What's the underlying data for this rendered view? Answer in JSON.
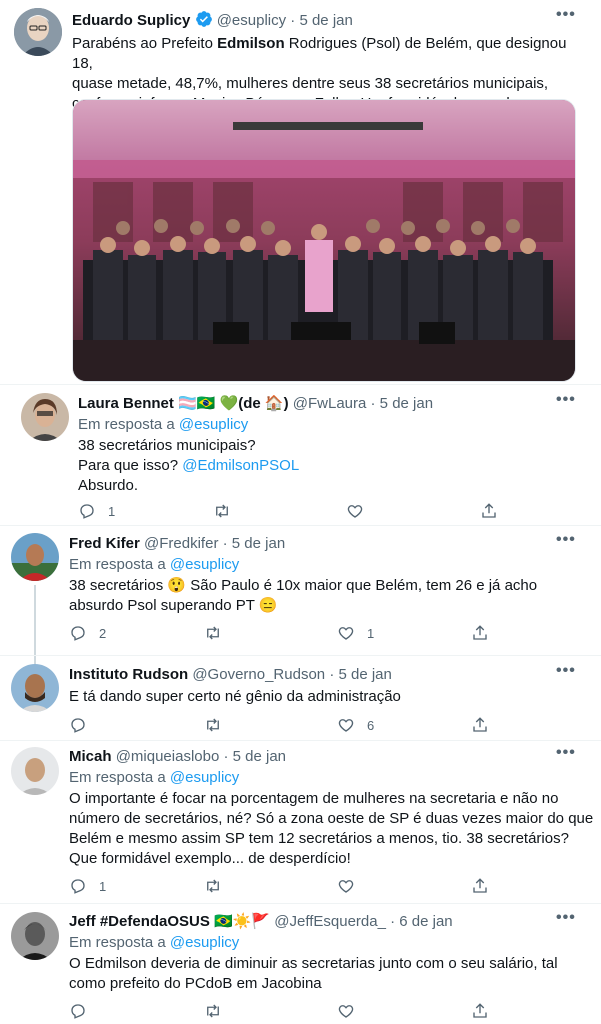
{
  "tweets": [
    {
      "name": "Eduardo Suplicy",
      "handle": "@esuplicy",
      "date": "· 5 de jan",
      "text_pre": "Parabéns ao Prefeito ",
      "text_bold": "Edmilson",
      "text_post": " Rodrigues (Psol) de Belém, que designou 18,",
      "text_line2": "quase metade, 48,7%, mulheres dentre seus 38 secretários municipais,",
      "text_line3": "conforme informa Monica Bérgamo, Folha. Um formidável exemplo.",
      "icon": "verified-badge-icon"
    },
    {
      "name": "Laura Bennet",
      "name_emoji": "🏳️‍⚧️🇧🇷 💚(de 🏠)",
      "handle": "@FwLaura",
      "date": "· 5 de jan",
      "reply_label": "Em resposta a",
      "reply_to": "@esuplicy",
      "line1": "38 secretários municipais?",
      "line2_pre": "Para que isso? ",
      "line2_link": "@EdmilsonPSOL",
      "line3": "Absurdo.",
      "replies": "1",
      "likes": ""
    },
    {
      "name": "Fred Kifer",
      "handle": "@Fredkifer",
      "date": "· 5 de jan",
      "reply_label": "Em resposta a",
      "reply_to": "@esuplicy",
      "line1": "38 secretários 😲 São Paulo é 10x maior que Belém, tem 26 e já acho",
      "line2": "absurdo Psol superando PT 😑",
      "replies": "2",
      "likes": "1"
    },
    {
      "name": "Instituto Rudson",
      "handle": "@Governo_Rudson",
      "date": "· 5 de jan",
      "line1": "E tá dando super certo né gênio da administração",
      "replies": "",
      "likes": "6"
    },
    {
      "name": "Micah",
      "handle": "@miqueiaslobo",
      "date": "· 5 de jan",
      "reply_label": "Em resposta a",
      "reply_to": "@esuplicy",
      "line1": "O importante é focar na porcentagem de mulheres na secretaria e não no",
      "line2": "número de secretários, né? Só a zona oeste de SP é duas vezes maior do que",
      "line3": "Belém e mesmo assim SP tem 12 secretários a menos, tio. 38 secretários?",
      "line4": "Que formidável exemplo... de desperdício!",
      "replies": "1",
      "likes": ""
    },
    {
      "name": "Jeff #DefendaOSUS",
      "name_emoji": "🇧🇷☀️🚩",
      "handle": "@JeffEsquerda_",
      "date": "· 6 de jan",
      "reply_label": "Em resposta a",
      "reply_to": "@esuplicy",
      "line1": "O Edmilson deveria de diminuir as secretarias junto com o seu salário, tal",
      "line2": "como prefeito do PCdoB em Jacobina"
    }
  ]
}
